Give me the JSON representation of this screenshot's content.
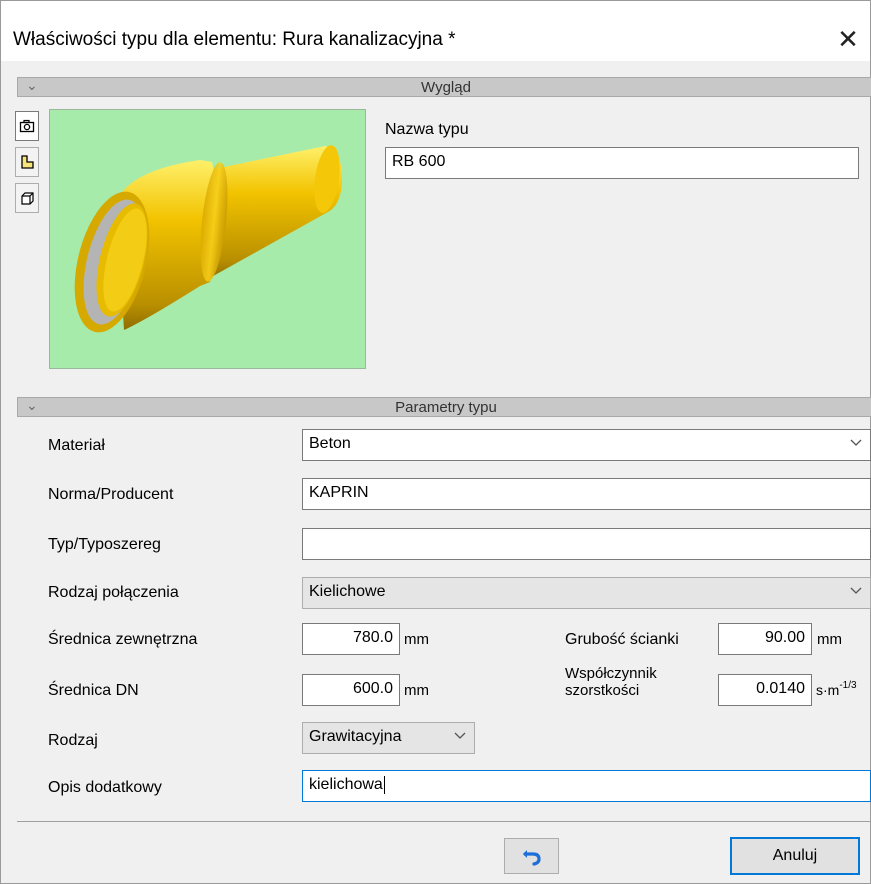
{
  "window": {
    "title": "Właściwości typu dla elementu: Rura kanalizacyjna *"
  },
  "sections": {
    "appearance": "Wygląd",
    "type_params": "Parametry typu"
  },
  "preview": {
    "background": "#a6ebaa",
    "pipe_color": "#f2c300"
  },
  "side_tabs": [
    "camera-view-icon",
    "2d-view-icon",
    "3d-view-icon"
  ],
  "type_name": {
    "label": "Nazwa typu",
    "value": "RB 600"
  },
  "fields": {
    "material": {
      "label": "Materiał",
      "value": "Beton"
    },
    "standard": {
      "label": "Norma/Producent",
      "value": "KAPRIN"
    },
    "series": {
      "label": "Typ/Typoszereg",
      "value": ""
    },
    "connection": {
      "label": "Rodzaj połączenia",
      "value": "Kielichowe"
    },
    "outer_diameter": {
      "label": "Średnica zewnętrzna",
      "value": "780.0",
      "unit": "mm"
    },
    "dn_diameter": {
      "label": "Średnica DN",
      "value": "600.0",
      "unit": "mm"
    },
    "wall_thickness": {
      "label": "Grubość ścianki",
      "value": "90.00",
      "unit": "mm"
    },
    "roughness": {
      "label_line1": "Współczynnik",
      "label_line2": "szorstkości",
      "value": "0.0140",
      "unit_base": "s·m",
      "unit_exp": "-1/3"
    },
    "kind": {
      "label": "Rodzaj",
      "value": "Grawitacyjna"
    },
    "description": {
      "label": "Opis dodatkowy",
      "value": "kielichowa"
    }
  },
  "buttons": {
    "undo": "undo-icon",
    "cancel": "Anuluj"
  },
  "colors": {
    "accent": "#0078d7",
    "undo_icon": "#1e6fd9"
  }
}
